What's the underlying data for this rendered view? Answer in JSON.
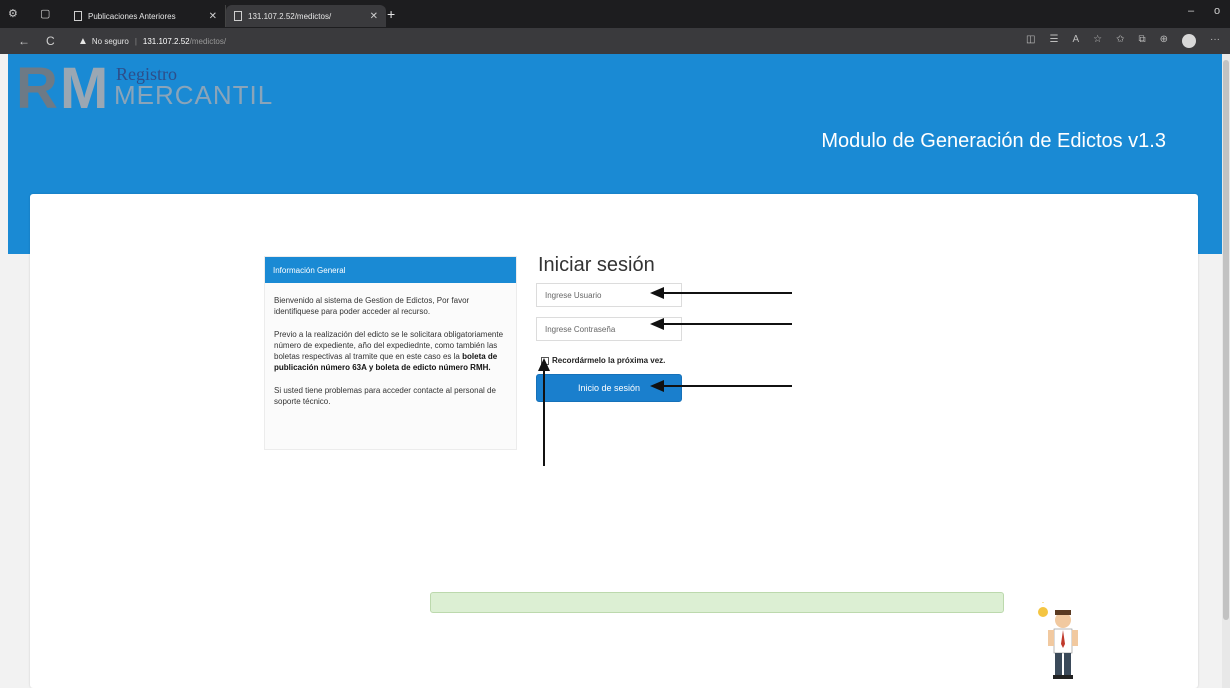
{
  "browser": {
    "tabs": [
      {
        "label": "Publicaciones Anteriores",
        "active": false
      },
      {
        "label": "131.107.2.52/medictos/",
        "active": true
      }
    ],
    "address": {
      "security_label": "No seguro",
      "host": "131.107.2.52",
      "path": "/medictos/"
    }
  },
  "header": {
    "logo_letters_r": "R",
    "logo_letters_m": "M",
    "brand_line1": "Registro",
    "brand_line2": "MERCANTIL",
    "module_title": "Modulo de Generación de Edictos v1.3"
  },
  "info": {
    "heading": "Información General",
    "para1": "Bienvenido al sistema de Gestion de Edictos, Por favor identifiquese para poder acceder al recurso.",
    "para2_pre": "Previo a la realización del edicto se le solicitara obligatoriamente número de expediente, año del expediednte, como también las boletas respectivas al tramite que en este caso es la",
    "para2_bold1": "boleta de publicación número 63A y boleta de edicto número RMH.",
    "para3": "Si usted tiene problemas para acceder contacte al personal de soporte técnico."
  },
  "login": {
    "title": "Iniciar sesión",
    "user_placeholder": "Ingrese Usuario",
    "pass_placeholder": "Ingrese Contraseña",
    "remember_label": "Recordármelo la próxima vez.",
    "submit_label": "Inicio de sesión"
  },
  "colors": {
    "brand_blue": "#1a8ad4",
    "button_blue": "#1a7fcd",
    "progress_green": "#dcefd3"
  }
}
